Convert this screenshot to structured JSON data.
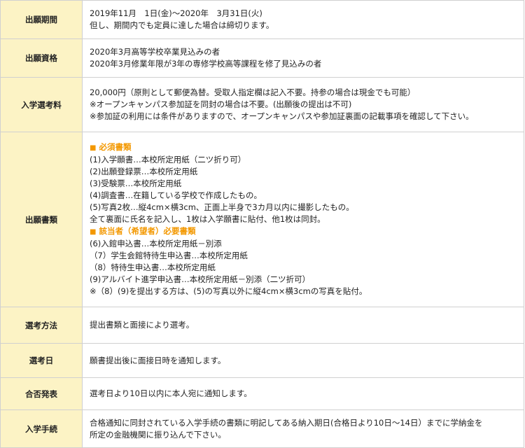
{
  "rows": [
    {
      "label": "出願期間",
      "lines": [
        "2019年11月　1日(金)～2020年　3月31日(火)",
        "但し、期間内でも定員に達した場合は締切ります。"
      ]
    },
    {
      "label": "出願資格",
      "lines": [
        "2020年3月高等学校卒業見込みの者",
        "2020年3月修業年限が3年の専修学校高等課程を修了見込みの者"
      ]
    },
    {
      "label": "入学選考料",
      "lines": [
        "20,000円（原則として郵便為替。受取人指定欄は記入不要。持参の場合は現金でも可能）",
        "※オープンキャンパス参加証を同封の場合は不要。(出願後の提出は不可)",
        "※参加証の利用には条件がありますので、オープンキャンパスや参加証裏面の記載事項を確認して下さい。"
      ]
    },
    {
      "label": "出願書類",
      "required_heading": "必須書類",
      "required_items": [
        "(1)入学願書…本校所定用紙（二ツ折り可）",
        "(2)出願登録票…本校所定用紙",
        "(3)受験票…本校所定用紙",
        "(4)調査書…在籍している学校で作成したもの。",
        "(5)写真2枚…縦4cm×横3cm、正面上半身で3カ月以内に撮影したもの。",
        "全て裏面に氏名を記入し、1枚は入学願書に貼付、他1枚は同封。"
      ],
      "conditional_heading": "該当者（希望者）必要書類",
      "conditional_items": [
        "(6)入館申込書…本校所定用紙－別添",
        "（7）学生会館特待生申込書…本校所定用紙",
        "（8）特待生申込書…本校所定用紙",
        "(9)アルバイト進学申込書…本校所定用紙－別添（二ツ折可）",
        "※（8）(9)を提出する方は、(5)の写真以外に縦4cm×横3cmの写真を貼付。"
      ]
    },
    {
      "label": "選考方法",
      "lines": [
        "提出書類と面接により選考。"
      ]
    },
    {
      "label": "選考日",
      "lines": [
        "願書提出後に面接日時を通知します。"
      ]
    },
    {
      "label": "合否発表",
      "lines": [
        "選考日より10日以内に本人宛に通知します。"
      ]
    },
    {
      "label": "入学手続",
      "lines": [
        "合格通知に同封されている入学手続の書類に明記してある納入期日(合格日より10日～14日）までに学納金を",
        "所定の金融機関に振り込んで下さい。"
      ]
    }
  ],
  "style": {
    "label_bg": "#fcf3c5",
    "heading_color": "#f39800",
    "border_color": "#d0d0d0"
  }
}
